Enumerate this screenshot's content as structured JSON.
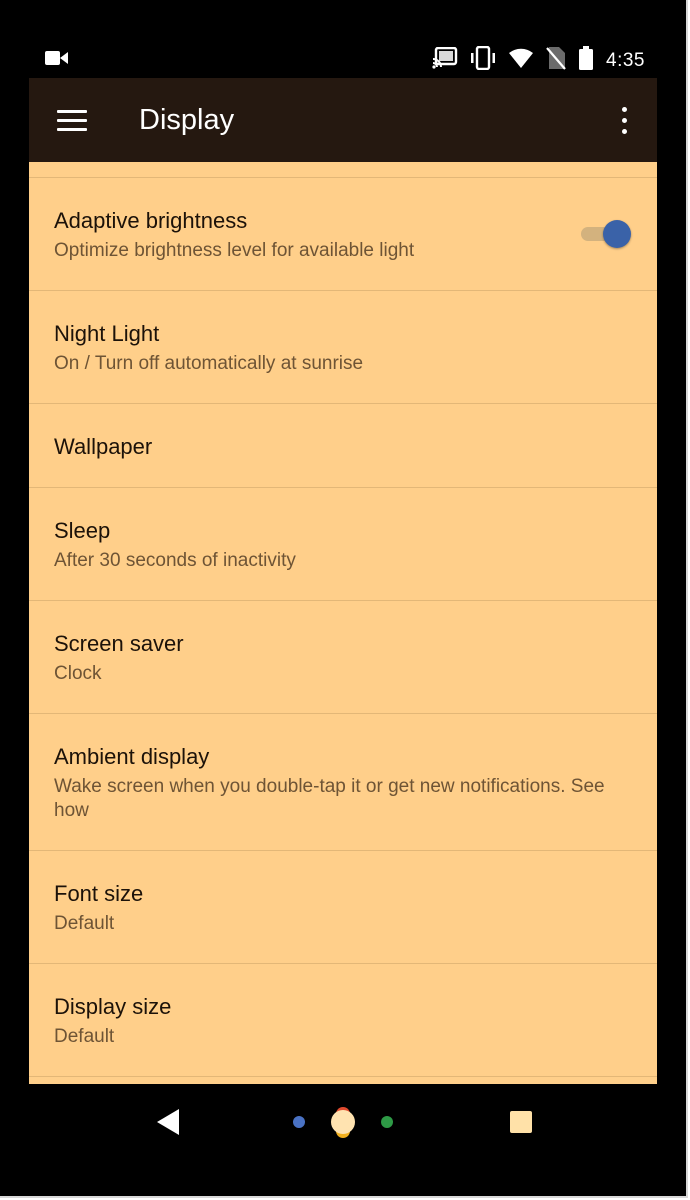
{
  "status_bar": {
    "time": "4:35",
    "icons": [
      "video-camera-icon",
      "cast-icon",
      "vibrate-icon",
      "wifi-icon",
      "no-sim-icon",
      "battery-icon"
    ]
  },
  "app_bar": {
    "title": "Display",
    "menu_icon": "hamburger-menu-icon",
    "overflow_icon": "more-vert-icon"
  },
  "settings": [
    {
      "title": "Adaptive brightness",
      "summary": "Optimize brightness level for available light",
      "toggle_on": true
    },
    {
      "title": "Night Light",
      "summary": "On / Turn off automatically at sunrise"
    },
    {
      "title": "Wallpaper",
      "summary": ""
    },
    {
      "title": "Sleep",
      "summary": "After 30 seconds of inactivity"
    },
    {
      "title": "Screen saver",
      "summary": "Clock"
    },
    {
      "title": "Ambient display",
      "summary": "Wake screen when you double-tap it or get new notifications. See how"
    },
    {
      "title": "Font size",
      "summary": "Default"
    },
    {
      "title": "Display size",
      "summary": "Default"
    }
  ],
  "nav_bar": {
    "icons": [
      "back-icon",
      "home-assistant-icon",
      "recents-icon"
    ]
  },
  "colors": {
    "content_background": "#ffcf8a",
    "app_bar_background": "#251810",
    "toggle_accent": "#3a62a8"
  }
}
